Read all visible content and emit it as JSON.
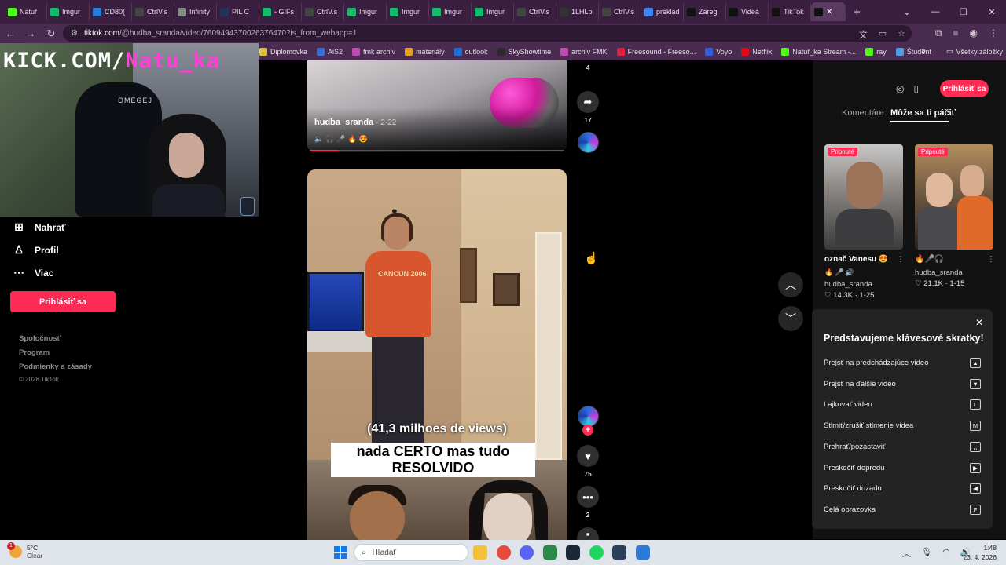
{
  "browser": {
    "tabs": [
      {
        "label": "Natuř",
        "color": "#53fc18"
      },
      {
        "label": "Imgur",
        "color": "#1bb76e"
      },
      {
        "label": "CD80(",
        "color": "#2b7bd8"
      },
      {
        "label": "CtrlV.s",
        "color": "#444444"
      },
      {
        "label": "Infinity",
        "color": "#888888"
      },
      {
        "label": "PIL C",
        "color": "#223355"
      },
      {
        "label": "- GIFs",
        "color": "#1bb76e"
      },
      {
        "label": "CtrlV.s",
        "color": "#444444"
      },
      {
        "label": "Imgur",
        "color": "#1bb76e"
      },
      {
        "label": "Imgur",
        "color": "#1bb76e"
      },
      {
        "label": "Imgur",
        "color": "#1bb76e"
      },
      {
        "label": "Imgur",
        "color": "#1bb76e"
      },
      {
        "label": "CtrlV.s",
        "color": "#444444"
      },
      {
        "label": "1LHLp",
        "color": "#333333"
      },
      {
        "label": "CtrlV.s",
        "color": "#444444"
      },
      {
        "label": "preklad",
        "color": "#4285f4"
      },
      {
        "label": "Zaregi",
        "color": "#111111"
      },
      {
        "label": "Videá",
        "color": "#111111"
      },
      {
        "label": "TikTok",
        "color": "#111111"
      }
    ],
    "active_tab_close": "✕",
    "new_tab": "+",
    "window_controls": [
      "⌄",
      "—",
      "❐",
      "✕"
    ],
    "address": {
      "host": "tiktok.com",
      "path": "/@hudba_sranda/video/7609494370026376470?is_from_webapp=1"
    },
    "bookmarks": [
      {
        "label": "Diplomovka",
        "color": "#e0c040"
      },
      {
        "label": "AiS2",
        "color": "#3a6fd8"
      },
      {
        "label": "fmk archiv",
        "color": "#c04ab0"
      },
      {
        "label": "materiály",
        "color": "#e6a020"
      },
      {
        "label": "outlook",
        "color": "#1f6fd8"
      },
      {
        "label": "SkyShowtime",
        "color": "#2a2a2a"
      },
      {
        "label": "archiv FMK",
        "color": "#c04ab0"
      },
      {
        "label": "Freesound - Freeso...",
        "color": "#e02040"
      },
      {
        "label": "Voyo",
        "color": "#3060e0"
      },
      {
        "label": "Netflix",
        "color": "#e50914"
      },
      {
        "label": "Natuř_ka Stream -...",
        "color": "#53fc18"
      },
      {
        "label": "ray",
        "color": "#53fc18"
      },
      {
        "label": "Študent",
        "color": "#4aa0e0"
      }
    ],
    "bookmarks_more": "»",
    "all_bookmarks": "Všetky záložky",
    "bookmark_x": "x"
  },
  "webcam": {
    "banner_white": "KICK.COM/",
    "banner_pink": "Natu_ka",
    "chair_logo": "OMEGEJ"
  },
  "nav": {
    "upload": "Nahrať",
    "profile": "Profil",
    "more": "Viac",
    "login": "Prihlásiť sa",
    "footer": [
      "Spoločnosť",
      "Program",
      "Podmienky a zásady"
    ],
    "copyright": "© 2026 TikTok"
  },
  "video1": {
    "username": "hudba_sranda",
    "date": "· 2-22",
    "emoji": "🔈🎧🎤🔥😍",
    "bookmarks_count": "4",
    "shares_count": "17"
  },
  "video2": {
    "caption_top": "(41,3 milhoes de views)",
    "caption_main": "nada CERTO mas tudo RESOLVIDO",
    "shirt_text": "CANCUN 2006",
    "likes": "75",
    "comments": "2"
  },
  "right": {
    "login": "Prihlásiť sa",
    "tabs": [
      "Komentáre",
      "Môže sa ti páčiť"
    ],
    "cards": [
      {
        "pinned": "Pripnuté",
        "title": "označ Vanesu 😍",
        "emoji": "🔥🎤🔊",
        "user": "hudba_sranda",
        "likes": "♡ 14.3K",
        "date": "· 1-25"
      },
      {
        "pinned": "Pripnuté",
        "title": "🔥🎤🎧",
        "emoji": "",
        "user": "hudba_sranda",
        "likes": "♡ 21.1K",
        "date": "· 1-15"
      }
    ],
    "shortcuts": {
      "title": "Predstavujeme klávesové skratky!",
      "items": [
        {
          "label": "Prejsť na predchádzajúce video",
          "key": "▲"
        },
        {
          "label": "Prejsť na ďalšie video",
          "key": "▼"
        },
        {
          "label": "Lajkovať video",
          "key": "L"
        },
        {
          "label": "Stlmiť/zrušiť stlmenie videa",
          "key": "M"
        },
        {
          "label": "Prehrať/pozastaviť",
          "key": "␣"
        },
        {
          "label": "Preskočiť dopredu",
          "key": "▶"
        },
        {
          "label": "Preskočiť dozadu",
          "key": "◀"
        },
        {
          "label": "Celá obrazovka",
          "key": "F"
        }
      ]
    }
  },
  "taskbar": {
    "weather_badge": "1",
    "temp": "5°C",
    "condition": "Clear",
    "search_placeholder": "Hľadať",
    "time": "1:48",
    "date": "23. 4. 2026",
    "apps": [
      {
        "name": "file-explorer",
        "color": "#f4c23a"
      },
      {
        "name": "chrome",
        "color": "#e64a3b"
      },
      {
        "name": "discord",
        "color": "#5865f2"
      },
      {
        "name": "app-green",
        "color": "#2a8a4a"
      },
      {
        "name": "steam",
        "color": "#1b2838"
      },
      {
        "name": "spotify",
        "color": "#1ed760"
      },
      {
        "name": "steam-2",
        "color": "#2a3f5a"
      },
      {
        "name": "app-blue",
        "color": "#2c7ad6"
      }
    ]
  }
}
